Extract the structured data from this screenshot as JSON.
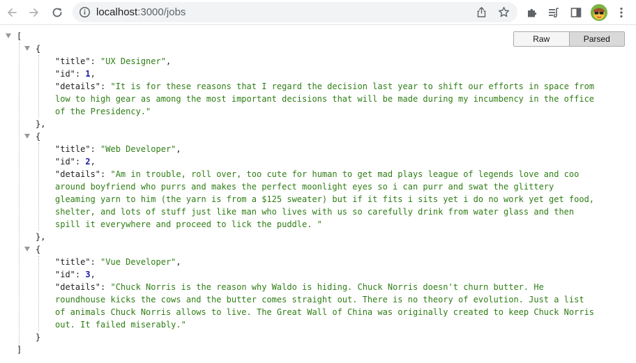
{
  "browser": {
    "url_host": "localhost",
    "url_path": ":3000/jobs"
  },
  "viewer": {
    "raw_label": "Raw",
    "parsed_label": "Parsed",
    "selected": "Parsed"
  },
  "json": {
    "open_array": "[",
    "close_array": "]",
    "open_object": "{",
    "close_object": "}",
    "close_object_comma": "},",
    "jobs": [
      {
        "title": "UX Designer",
        "id": "1",
        "details_lines": [
          "\"It is for these reasons that I regard the decision last year to shift our efforts in space from",
          "low to high gear as among the most important decisions that will be made during my incumbency in the office",
          "of the Presidency.\""
        ]
      },
      {
        "title": "Web Developer",
        "id": "2",
        "details_lines": [
          "\"Am in trouble, roll over, too cute for human to get mad plays league of legends love and coo",
          "around boyfriend who purrs and makes the perfect moonlight eyes so i can purr and swat the glittery",
          "gleaming yarn to him (the yarn is from a $125 sweater) but if it fits i sits yet i do no work yet get food,",
          "shelter, and lots of stuff just like man who lives with us so carefully drink from water glass and then",
          "spill it everywhere and proceed to lick the puddle. \""
        ]
      },
      {
        "title": "Vue Developer",
        "id": "3",
        "details_lines": [
          "\"Chuck Norris is the reason why Waldo is hiding. Chuck Norris doesn't churn butter. He",
          "roundhouse kicks the cows and the butter comes straight out. There is no theory of evolution. Just a list",
          "of animals Chuck Norris allows to live. The Great Wall of China was originally created to keep Chuck Norris",
          "out. It failed miserably.\""
        ]
      }
    ]
  },
  "colors": {
    "string": "#2e7d14",
    "number": "#1a1aa6",
    "key": "#222222"
  },
  "icons": [
    "back-arrow-icon",
    "forward-arrow-icon",
    "reload-icon",
    "info-icon",
    "share-icon",
    "star-icon",
    "extensions-icon",
    "reading-list-icon",
    "side-panel-icon",
    "avatar",
    "kebab-menu-icon",
    "collapse-arrow-icon"
  ]
}
